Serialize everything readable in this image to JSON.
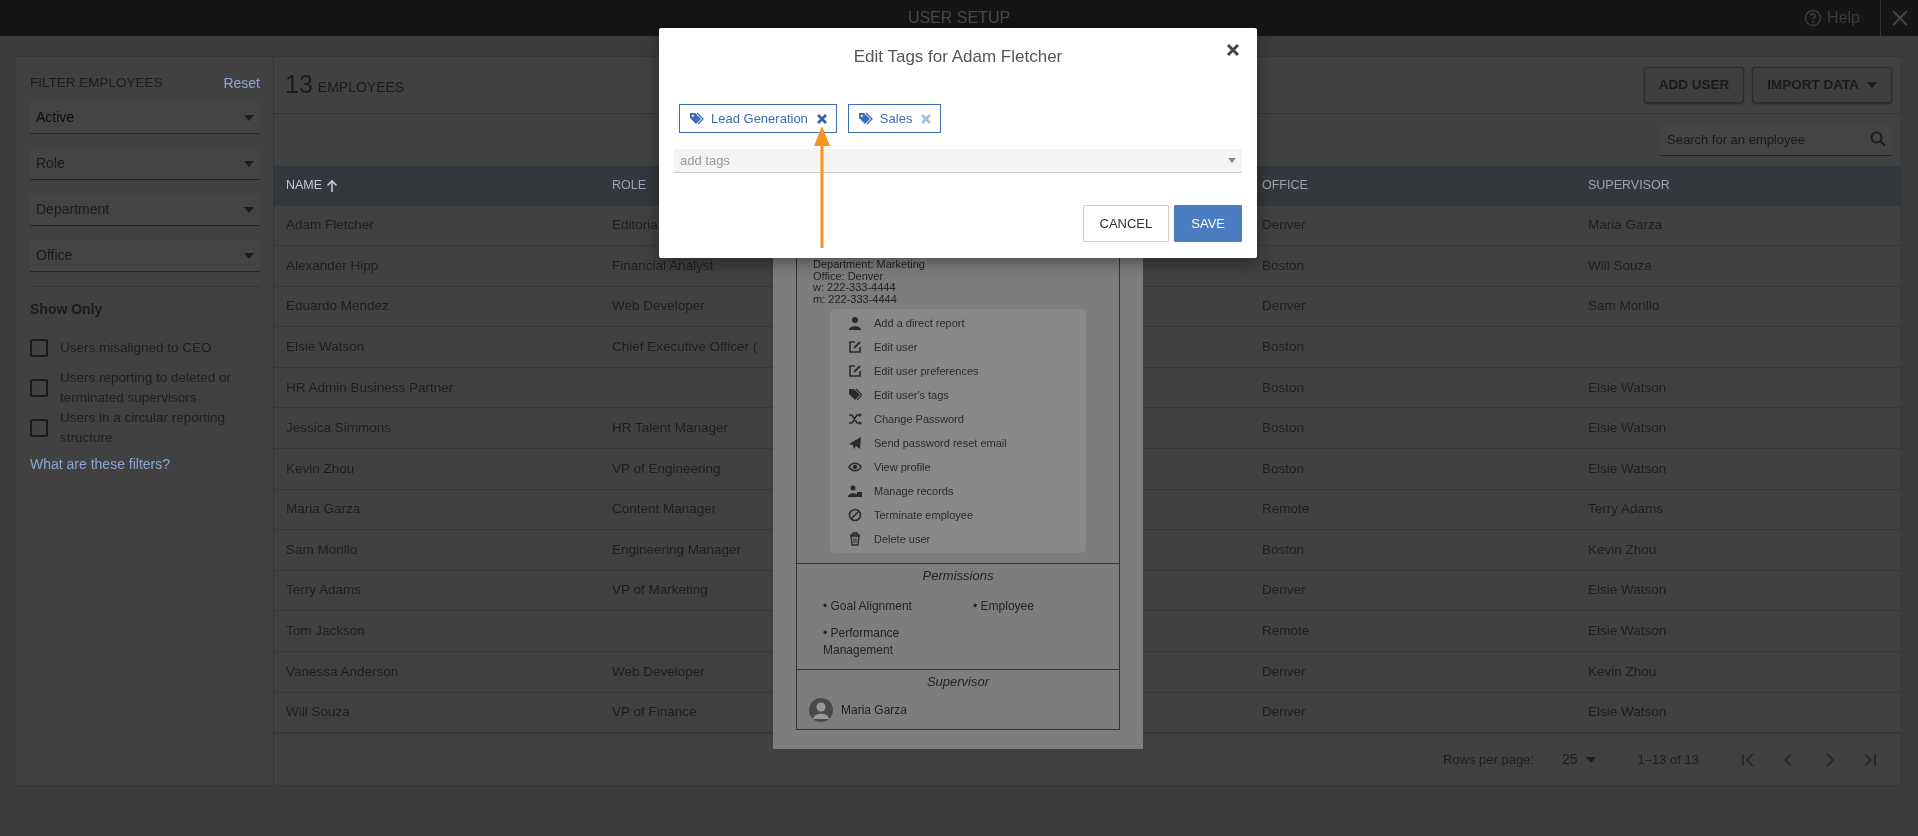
{
  "top_bar": {
    "title": "USER SETUP",
    "help": "Help"
  },
  "filters": {
    "title": "FILTER EMPLOYEES",
    "reset": "Reset",
    "selects": [
      {
        "value": "Active"
      },
      {
        "placeholder": "Role"
      },
      {
        "placeholder": "Department"
      },
      {
        "placeholder": "Office"
      }
    ],
    "show_only_title": "Show Only",
    "checkboxes": [
      {
        "label": "Users misaligned to CEO",
        "checked": false
      },
      {
        "label": "Users reporting to deleted or terminated supervisors",
        "checked": false
      },
      {
        "label": "Users in a circular reporting structure",
        "checked": false
      }
    ],
    "help_link": "What are these filters?"
  },
  "header": {
    "count": "13",
    "count_label": "EMPLOYEES",
    "buttons": [
      {
        "label": "ADD USER",
        "kind": "plain"
      },
      {
        "label": "IMPORT DATA",
        "kind": "dropdown"
      }
    ]
  },
  "search": {
    "placeholder": "Search for an employee"
  },
  "table": {
    "columns": [
      {
        "label": "NAME",
        "sorted": true
      },
      {
        "label": "ROLE",
        "sorted": false
      },
      {
        "label": "OFFICE",
        "sorted": false
      },
      {
        "label": "SUPERVISOR",
        "sorted": false
      }
    ],
    "rows": [
      {
        "name": "Adam Fletcher",
        "role": "Editoria",
        "office": "Denver",
        "supervisor": "Maria Garza"
      },
      {
        "name": "Alexander Hipp",
        "role": "Financial Analyst",
        "office": "Boston",
        "supervisor": "Will Souza"
      },
      {
        "name": "Eduardo Mendez",
        "role": "Web Developer",
        "office": "Denver",
        "supervisor": "Sam Morillo"
      },
      {
        "name": "Elsie Watson",
        "role": "Chief Executive Officer (",
        "office": "Boston"
      },
      {
        "name": "HR Admin Business Partner",
        "office": "Boston",
        "supervisor": "Elsie Watson"
      },
      {
        "name": "Jessica Simmons",
        "role": "HR Talent Manager",
        "office": "Boston",
        "supervisor": "Elsie Watson"
      },
      {
        "name": "Kevin Zhou",
        "role": "VP of Engineering",
        "office": "Boston",
        "supervisor": "Elsie Watson"
      },
      {
        "name": "Maria Garza",
        "role": "Content Manager",
        "office": "Remote",
        "supervisor": "Terry Adams"
      },
      {
        "name": "Sam Morillo",
        "role": "Engineering Manager",
        "office": "Boston",
        "supervisor": "Kevin Zhou"
      },
      {
        "name": "Terry Adams",
        "role": "VP of Marketing",
        "office": "Denver",
        "supervisor": "Elsie Watson"
      },
      {
        "name": "Tom Jackson",
        "office": "Remote",
        "supervisor": "Elsie Watson"
      },
      {
        "name": "Vanessa Anderson",
        "role": "Web Developer",
        "office": "Denver",
        "supervisor": "Kevin Zhou"
      },
      {
        "name": "Will Souza",
        "role": "VP of Finance",
        "office": "Denver",
        "supervisor": "Elsie Watson"
      }
    ]
  },
  "pagination": {
    "rows_label": "Rows per page:",
    "rows_value": "25",
    "range": "1–13 of 13"
  },
  "profile_card": {
    "details": [
      "Department: Marketing",
      "Office: Denver",
      "w: 222-333-4444",
      "m: 222-333-4444"
    ],
    "menu": [
      "Add a direct report",
      "Edit user",
      "Edit user preferences",
      "Edit user's tags",
      "Change Password",
      "Send password reset email",
      "View profile",
      "Manage records",
      "Terminate employee",
      "Delete user"
    ],
    "permissions_title": "Permissions",
    "permissions": [
      "• Goal Alignment",
      "• Employee",
      "• Performance Management"
    ],
    "supervisor_title": "Supervisor",
    "supervisor": "Maria Garza"
  },
  "modal": {
    "title": "Edit Tags for Adam Fletcher",
    "tags": [
      {
        "label": "Lead Generation",
        "hover": true
      },
      {
        "label": "Sales",
        "hover": false
      }
    ],
    "add_placeholder": "add tags",
    "buttons": [
      {
        "label": "CANCEL",
        "kind": "secondary"
      },
      {
        "label": "SAVE",
        "kind": "primary"
      }
    ]
  }
}
